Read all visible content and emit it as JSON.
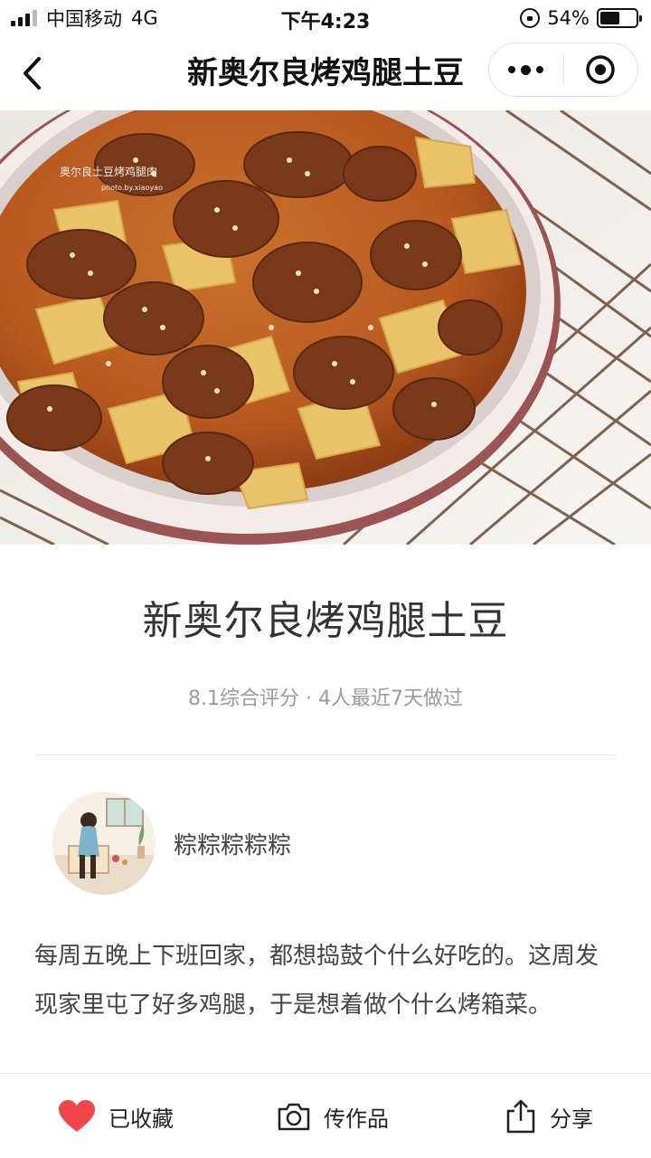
{
  "status_bar": {
    "carrier": "中国移动",
    "network": "4G",
    "time": "下午4:23",
    "battery": "54%",
    "battery_level": 0.54
  },
  "nav": {
    "title": "新奥尔良烤鸡腿土豆",
    "back_icon": "chevron-left-icon",
    "more_icon": "more-dots-icon",
    "close_icon": "target-circle-icon"
  },
  "hero": {
    "watermark_line1": "奥尔良土豆烤鸡腿肉",
    "watermark_line2": "photo.by.xiaoyao"
  },
  "recipe": {
    "title": "新奥尔良烤鸡腿土豆",
    "meta": "8.1综合评分 · 4人最近7天做过"
  },
  "author": {
    "name": "粽粽粽粽粽"
  },
  "description": "每周五晚上下班回家，都想捣鼓个什么好吃的。这周发现家里屯了好多鸡腿，于是想着做个什么烤箱菜。",
  "bottom_bar": {
    "favorite_label": "已收藏",
    "upload_label": "传作品",
    "share_label": "分享"
  },
  "colors": {
    "heart": "#f2454a",
    "title_text": "#333333",
    "meta_text": "#9b9b9b"
  }
}
